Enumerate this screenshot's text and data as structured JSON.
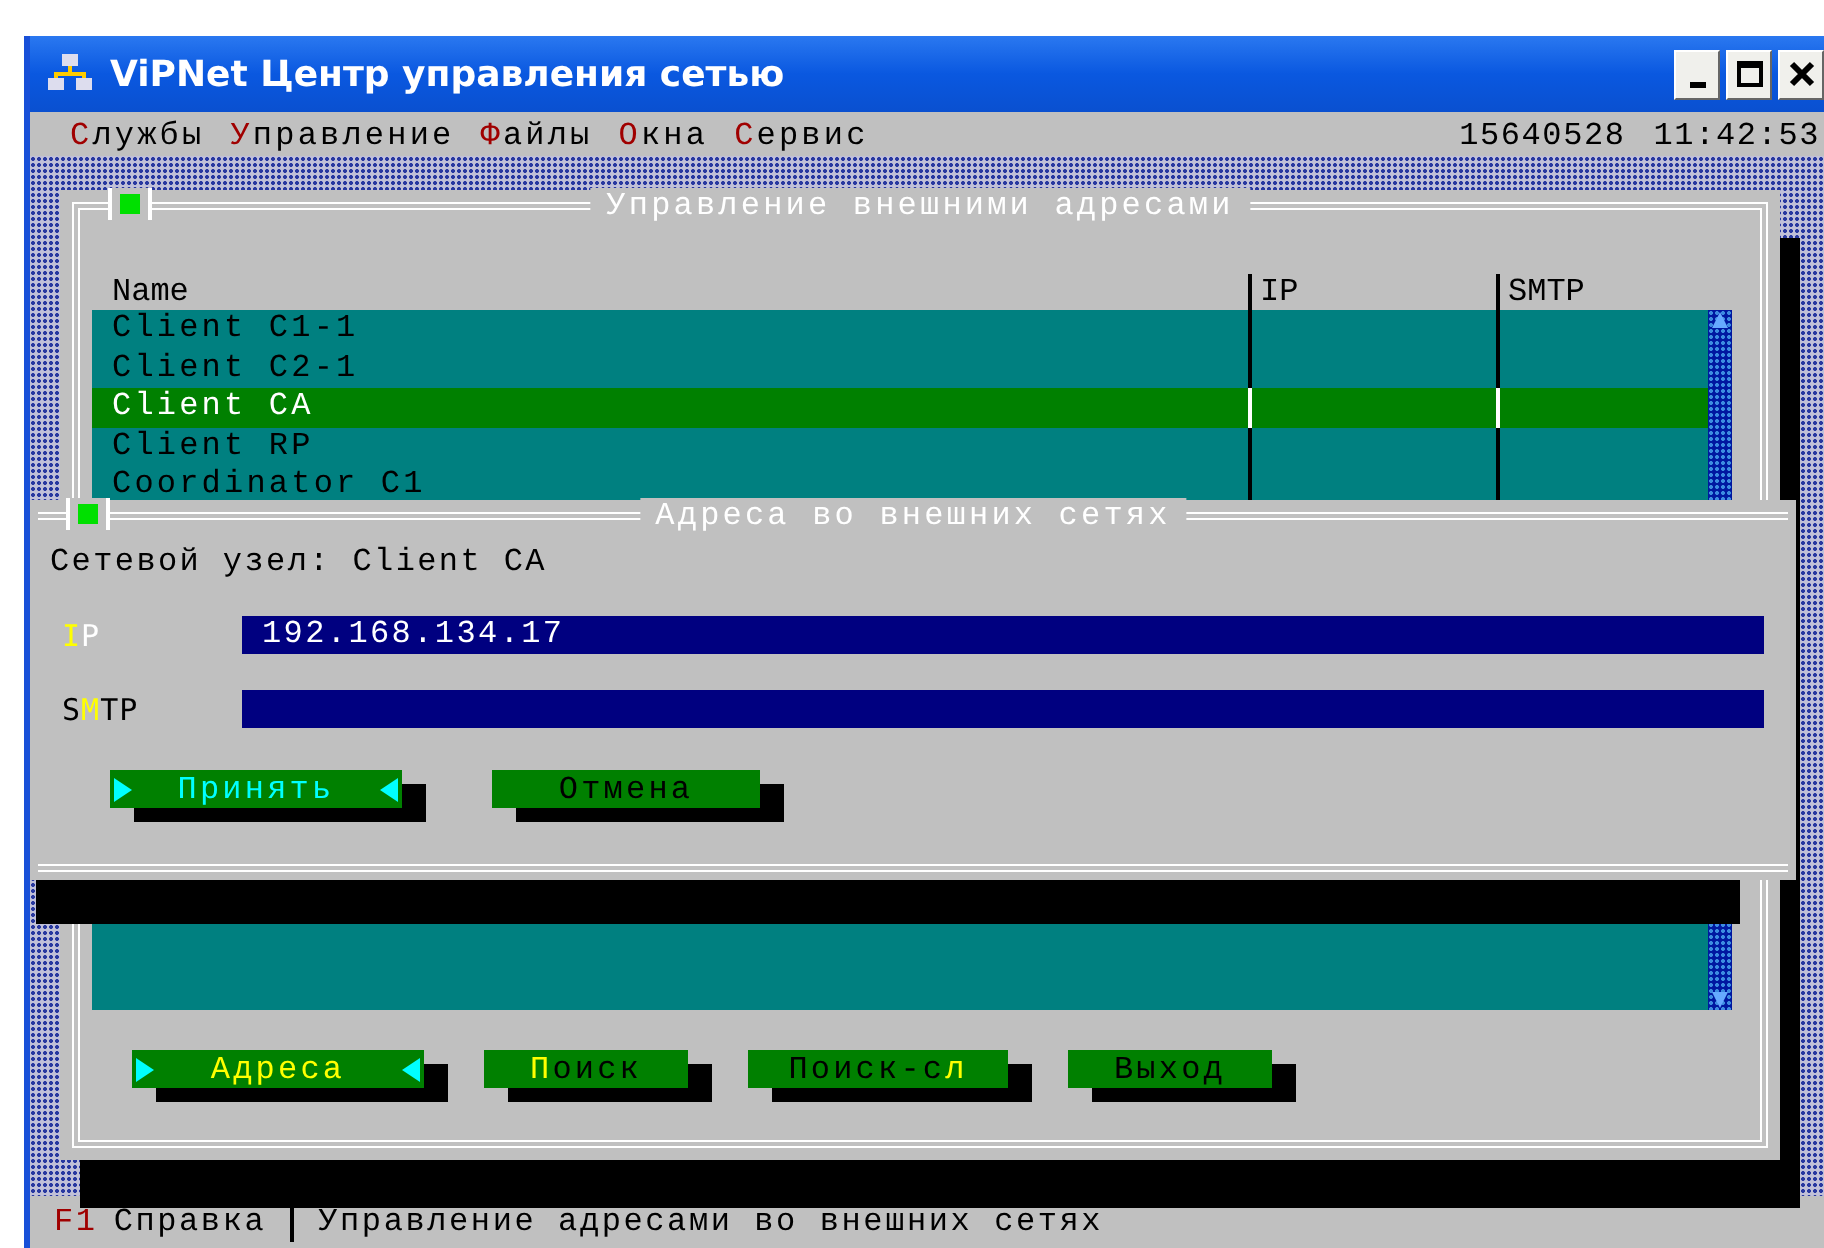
{
  "window": {
    "title": "ViPNet Центр управления сетью"
  },
  "menu": [
    {
      "key": "С",
      "rest": "лужбы"
    },
    {
      "key": "У",
      "rest": "правление"
    },
    {
      "key": "Ф",
      "rest": "айлы"
    },
    {
      "key": "О",
      "rest": "кна"
    },
    {
      "key": "С",
      "rest": "ервис"
    }
  ],
  "menu_info": [
    "15640528",
    "11:42:53"
  ],
  "panel": {
    "title": "Управление внешними адресами",
    "table": {
      "columns": [
        "Name",
        "IP",
        "SMTP"
      ],
      "rows": [
        {
          "name": "Client C1-1",
          "selected": false
        },
        {
          "name": "Client C2-1",
          "selected": false
        },
        {
          "name": "Client CA",
          "selected": true
        },
        {
          "name": "Client RP",
          "selected": false
        },
        {
          "name": "Coordinator C1",
          "selected": false
        }
      ]
    },
    "buttons": [
      {
        "rest": "Адреса",
        "selected": true
      },
      {
        "key": "П",
        "rest": "оиск",
        "selected": false
      },
      {
        "pre": "Поиск-с",
        "key": "л",
        "selected": false
      },
      {
        "pre": "Выход",
        "selected": false
      }
    ]
  },
  "dialog": {
    "title": "Адреса во внешних сетях",
    "node_label": "Сетевой узел: Client CA",
    "fields": [
      {
        "key": "I",
        "rest": "P",
        "value": "192.168.134.17"
      },
      {
        "pre": "S",
        "key": "M",
        "rest": "TP"
      }
    ],
    "buttons": [
      {
        "pre": "Принять",
        "selected": true
      },
      {
        "pre": "Отмена",
        "selected": false
      }
    ]
  },
  "status_bar": {
    "key": "F1",
    "key_label": "Справка",
    "message": "Управление адресами во внешних сетях"
  }
}
